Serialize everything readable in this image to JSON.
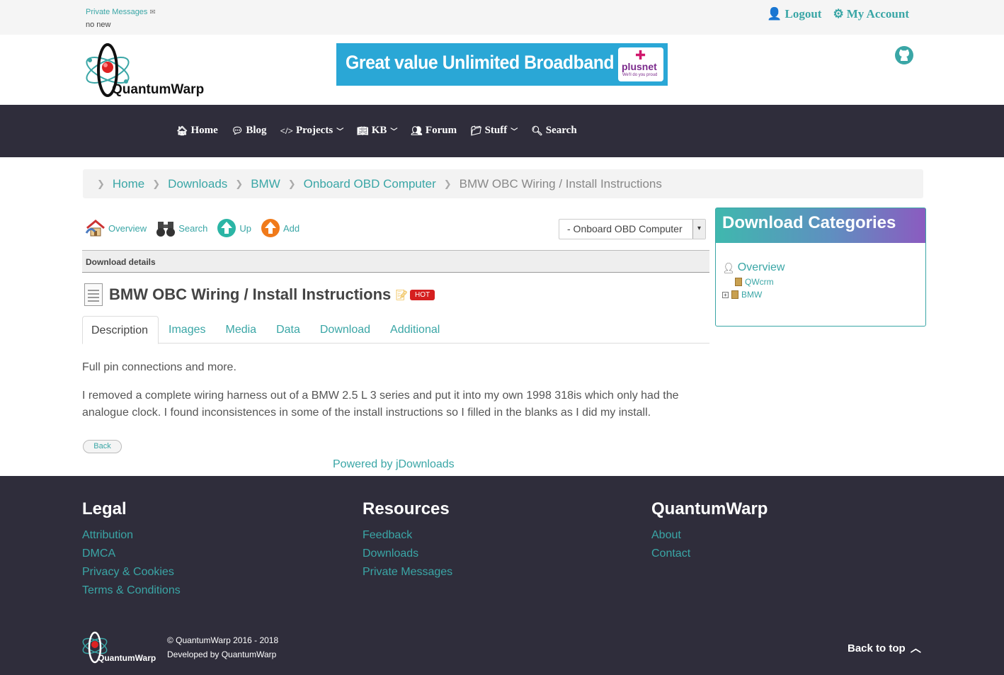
{
  "topbar": {
    "pm_label": "Private Messages",
    "pm_status": "no new",
    "logout": "Logout",
    "my_account": "My Account"
  },
  "header": {
    "logo_text": "QuantumWarp",
    "banner_text": "Great value Unlimited Broadband",
    "banner_brand": "plusnet",
    "banner_tagline": "We'll do you proud"
  },
  "nav": {
    "home": "Home",
    "blog": "Blog",
    "projects": "Projects",
    "kb": "KB",
    "forum": "Forum",
    "stuff": "Stuff",
    "search": "Search"
  },
  "breadcrumb": {
    "items": [
      "Home",
      "Downloads",
      "BMW",
      "Onboard OBD Computer"
    ],
    "current": "BMW OBC Wiring / Install Instructions"
  },
  "toolbar": {
    "overview": "Overview",
    "search": "Search",
    "up": "Up",
    "add": "Add",
    "category_selected": "- Onboard OBD Computer"
  },
  "download": {
    "section_heading": "Download details",
    "title": "BMW OBC Wiring / Install Instructions",
    "hot_badge": "HOT",
    "tabs": [
      "Description",
      "Images",
      "Media",
      "Data",
      "Download",
      "Additional"
    ],
    "paragraph1": "Full pin connections and more.",
    "paragraph2": "I removed a complete wiring harness out of a BMW 2.5 L 3 series and put it into my own 1998 318is which only had the analogue clock. I found inconsistences in some of the install instructions so I filled in the blanks as I did my install.",
    "back_label": "Back",
    "powered_by": "Powered by jDownloads"
  },
  "sidebar": {
    "heading": "Download Categories",
    "overview": "Overview",
    "cat1": "QWcrm",
    "cat2": "BMW"
  },
  "footer": {
    "legal_heading": "Legal",
    "legal_links": [
      "Attribution",
      "DMCA",
      "Privacy & Cookies",
      "Terms & Conditions"
    ],
    "resources_heading": "Resources",
    "resources_links": [
      "Feedback",
      "Downloads",
      "Private Messages"
    ],
    "qw_heading": "QuantumWarp",
    "qw_links": [
      "About",
      "Contact"
    ],
    "copyright": "© QuantumWarp 2016 - 2018",
    "developed_by": "Developed by QuantumWarp",
    "logo_text": "QuantumWarp",
    "back_to_top": "Back to top"
  },
  "colors": {
    "accent": "#3aa6a6",
    "nav_bg": "#2f2d3b",
    "hot": "#d51f1f"
  }
}
